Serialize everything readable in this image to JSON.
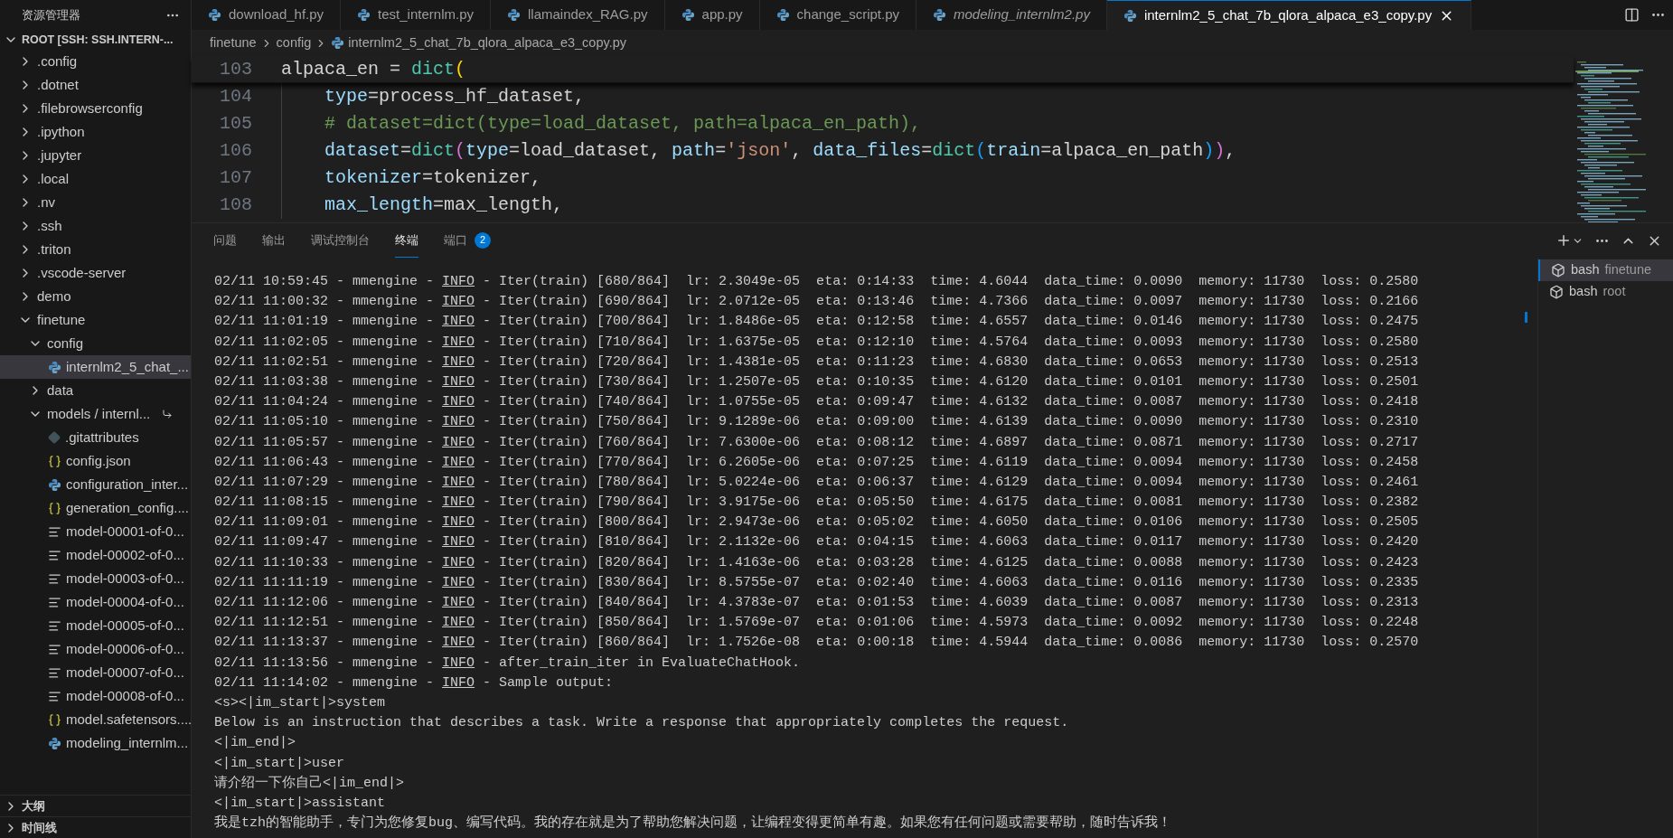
{
  "sidebar": {
    "title": "资源管理器",
    "root": {
      "label": "ROOT [SSH: SSH.INTERN-...",
      "expanded": true,
      "children": [
        {
          "label": ".config",
          "kind": "folder",
          "expanded": false,
          "selected": false
        },
        {
          "label": ".dotnet",
          "kind": "folder",
          "expanded": false,
          "selected": false
        },
        {
          "label": ".filebrowserconfig",
          "kind": "folder",
          "expanded": false,
          "selected": false
        },
        {
          "label": ".ipython",
          "kind": "folder",
          "expanded": false,
          "selected": false
        },
        {
          "label": ".jupyter",
          "kind": "folder",
          "expanded": false,
          "selected": false
        },
        {
          "label": ".local",
          "kind": "folder",
          "expanded": false,
          "selected": false
        },
        {
          "label": ".nv",
          "kind": "folder",
          "expanded": false,
          "selected": false
        },
        {
          "label": ".ssh",
          "kind": "folder",
          "expanded": false,
          "selected": false
        },
        {
          "label": ".triton",
          "kind": "folder",
          "expanded": false,
          "selected": false
        },
        {
          "label": ".vscode-server",
          "kind": "folder",
          "expanded": false,
          "selected": false
        },
        {
          "label": "demo",
          "kind": "folder",
          "expanded": false,
          "selected": false
        },
        {
          "label": "finetune",
          "kind": "folder",
          "expanded": true,
          "selected": false,
          "children": [
            {
              "label": "config",
              "kind": "folder",
              "expanded": true,
              "selected": false,
              "children": [
                {
                  "label": "internlm2_5_chat_...",
                  "kind": "python",
                  "selected": true
                }
              ]
            },
            {
              "label": "data",
              "kind": "folder",
              "expanded": false,
              "selected": false
            },
            {
              "label": "models / internl...",
              "kind": "folder",
              "expanded": true,
              "selected": false,
              "symlink": true,
              "children": [
                {
                  "label": ".gitattributes",
                  "kind": "git",
                  "selected": false
                },
                {
                  "label": "config.json",
                  "kind": "json",
                  "selected": false
                },
                {
                  "label": "configuration_inter...",
                  "kind": "python",
                  "selected": false
                },
                {
                  "label": "generation_config....",
                  "kind": "json",
                  "selected": false
                },
                {
                  "label": "model-00001-of-0...",
                  "kind": "text",
                  "selected": false
                },
                {
                  "label": "model-00002-of-0...",
                  "kind": "text",
                  "selected": false
                },
                {
                  "label": "model-00003-of-0...",
                  "kind": "text",
                  "selected": false
                },
                {
                  "label": "model-00004-of-0...",
                  "kind": "text",
                  "selected": false
                },
                {
                  "label": "model-00005-of-0...",
                  "kind": "text",
                  "selected": false
                },
                {
                  "label": "model-00006-of-0...",
                  "kind": "text",
                  "selected": false
                },
                {
                  "label": "model-00007-of-0...",
                  "kind": "text",
                  "selected": false
                },
                {
                  "label": "model-00008-of-0...",
                  "kind": "text",
                  "selected": false
                },
                {
                  "label": "model.safetensors....",
                  "kind": "json",
                  "selected": false
                },
                {
                  "label": "modeling_internlm...",
                  "kind": "python",
                  "selected": false
                }
              ]
            }
          ]
        }
      ]
    },
    "sections": [
      {
        "label": "大纲",
        "expanded": false
      },
      {
        "label": "时间线",
        "expanded": false
      }
    ]
  },
  "tabs": [
    {
      "label": "download_hf.py",
      "selected": false,
      "preview": false
    },
    {
      "label": "test_internlm.py",
      "selected": false,
      "preview": false
    },
    {
      "label": "llamaindex_RAG.py",
      "selected": false,
      "preview": false
    },
    {
      "label": "app.py",
      "selected": false,
      "preview": false
    },
    {
      "label": "change_script.py",
      "selected": false,
      "preview": false
    },
    {
      "label": "modeling_internlm2.py",
      "selected": false,
      "preview": true
    },
    {
      "label": "internlm2_5_chat_7b_qlora_alpaca_e3_copy.py",
      "selected": true,
      "preview": false
    }
  ],
  "breadcrumb": [
    "finetune",
    "config",
    "internlm2_5_chat_7b_qlora_alpaca_e3_copy.py"
  ],
  "code_lines": [
    {
      "number": "103",
      "sticky": true,
      "indented": false,
      "tokens": [
        {
          "text": "alpaca_en",
          "kind": "plain"
        },
        {
          "text": " = ",
          "kind": "plain"
        },
        {
          "text": "dict",
          "kind": "func"
        },
        {
          "text": "(",
          "kind": "paren1"
        }
      ]
    },
    {
      "number": "104",
      "sticky": false,
      "indented": true,
      "tokens": [
        {
          "text": "type",
          "kind": "param"
        },
        {
          "text": "=process_hf_dataset,",
          "kind": "plain"
        }
      ]
    },
    {
      "number": "105",
      "sticky": false,
      "indented": true,
      "tokens": [
        {
          "text": "# dataset=dict(type=load_dataset, path=alpaca_en_path),",
          "kind": "comment"
        }
      ]
    },
    {
      "number": "106",
      "sticky": false,
      "indented": true,
      "tokens": [
        {
          "text": "dataset",
          "kind": "param"
        },
        {
          "text": "=",
          "kind": "plain"
        },
        {
          "text": "dict",
          "kind": "func"
        },
        {
          "text": "(",
          "kind": "paren2"
        },
        {
          "text": "type",
          "kind": "param"
        },
        {
          "text": "=load_dataset, ",
          "kind": "plain"
        },
        {
          "text": "path",
          "kind": "param"
        },
        {
          "text": "=",
          "kind": "plain"
        },
        {
          "text": "'json'",
          "kind": "string"
        },
        {
          "text": ", ",
          "kind": "plain"
        },
        {
          "text": "data_files",
          "kind": "param"
        },
        {
          "text": "=",
          "kind": "plain"
        },
        {
          "text": "dict",
          "kind": "func"
        },
        {
          "text": "(",
          "kind": "paren3"
        },
        {
          "text": "train",
          "kind": "param"
        },
        {
          "text": "=alpaca_en_path",
          "kind": "plain"
        },
        {
          "text": ")",
          "kind": "paren3"
        },
        {
          "text": ")",
          "kind": "paren2"
        },
        {
          "text": ",",
          "kind": "plain"
        }
      ]
    },
    {
      "number": "107",
      "sticky": false,
      "indented": true,
      "tokens": [
        {
          "text": "tokenizer",
          "kind": "param"
        },
        {
          "text": "=tokenizer,",
          "kind": "plain"
        }
      ]
    },
    {
      "number": "108",
      "sticky": false,
      "indented": true,
      "tokens": [
        {
          "text": "max_length",
          "kind": "param"
        },
        {
          "text": "=max_length,",
          "kind": "plain"
        }
      ]
    }
  ],
  "panel_tabs": [
    {
      "label": "问题",
      "selected": false
    },
    {
      "label": "输出",
      "selected": false
    },
    {
      "label": "调试控制台",
      "selected": false
    },
    {
      "label": "终端",
      "selected": true
    },
    {
      "label": "端口",
      "selected": false,
      "badge": "2"
    }
  ],
  "terminal": {
    "lines": [
      {
        "kind": "log",
        "prefix": "02/11 10:59:45 - mmengine - ",
        "level": "INFO",
        "message": " - Iter(train) [680/864]  lr: 2.3049e-05  eta: 0:14:33  time: 4.6044  data_time: 0.0090  memory: 11730  loss: 0.2580"
      },
      {
        "kind": "log",
        "prefix": "02/11 11:00:32 - mmengine - ",
        "level": "INFO",
        "message": " - Iter(train) [690/864]  lr: 2.0712e-05  eta: 0:13:46  time: 4.7366  data_time: 0.0097  memory: 11730  loss: 0.2166"
      },
      {
        "kind": "log",
        "prefix": "02/11 11:01:19 - mmengine - ",
        "level": "INFO",
        "message": " - Iter(train) [700/864]  lr: 1.8486e-05  eta: 0:12:58  time: 4.6557  data_time: 0.0146  memory: 11730  loss: 0.2475"
      },
      {
        "kind": "log",
        "prefix": "02/11 11:02:05 - mmengine - ",
        "level": "INFO",
        "message": " - Iter(train) [710/864]  lr: 1.6375e-05  eta: 0:12:10  time: 4.5764  data_time: 0.0093  memory: 11730  loss: 0.2580"
      },
      {
        "kind": "log",
        "prefix": "02/11 11:02:51 - mmengine - ",
        "level": "INFO",
        "message": " - Iter(train) [720/864]  lr: 1.4381e-05  eta: 0:11:23  time: 4.6830  data_time: 0.0653  memory: 11730  loss: 0.2513"
      },
      {
        "kind": "log",
        "prefix": "02/11 11:03:38 - mmengine - ",
        "level": "INFO",
        "message": " - Iter(train) [730/864]  lr: 1.2507e-05  eta: 0:10:35  time: 4.6120  data_time: 0.0101  memory: 11730  loss: 0.2501"
      },
      {
        "kind": "log",
        "prefix": "02/11 11:04:24 - mmengine - ",
        "level": "INFO",
        "message": " - Iter(train) [740/864]  lr: 1.0755e-05  eta: 0:09:47  time: 4.6132  data_time: 0.0087  memory: 11730  loss: 0.2418"
      },
      {
        "kind": "log",
        "prefix": "02/11 11:05:10 - mmengine - ",
        "level": "INFO",
        "message": " - Iter(train) [750/864]  lr: 9.1289e-06  eta: 0:09:00  time: 4.6139  data_time: 0.0090  memory: 11730  loss: 0.2310"
      },
      {
        "kind": "log",
        "prefix": "02/11 11:05:57 - mmengine - ",
        "level": "INFO",
        "message": " - Iter(train) [760/864]  lr: 7.6300e-06  eta: 0:08:12  time: 4.6897  data_time: 0.0871  memory: 11730  loss: 0.2717"
      },
      {
        "kind": "log",
        "prefix": "02/11 11:06:43 - mmengine - ",
        "level": "INFO",
        "message": " - Iter(train) [770/864]  lr: 6.2605e-06  eta: 0:07:25  time: 4.6119  data_time: 0.0094  memory: 11730  loss: 0.2458"
      },
      {
        "kind": "log",
        "prefix": "02/11 11:07:29 - mmengine - ",
        "level": "INFO",
        "message": " - Iter(train) [780/864]  lr: 5.0224e-06  eta: 0:06:37  time: 4.6129  data_time: 0.0094  memory: 11730  loss: 0.2461"
      },
      {
        "kind": "log",
        "prefix": "02/11 11:08:15 - mmengine - ",
        "level": "INFO",
        "message": " - Iter(train) [790/864]  lr: 3.9175e-06  eta: 0:05:50  time: 4.6175  data_time: 0.0081  memory: 11730  loss: 0.2382"
      },
      {
        "kind": "log",
        "prefix": "02/11 11:09:01 - mmengine - ",
        "level": "INFO",
        "message": " - Iter(train) [800/864]  lr: 2.9473e-06  eta: 0:05:02  time: 4.6050  data_time: 0.0106  memory: 11730  loss: 0.2505"
      },
      {
        "kind": "log",
        "prefix": "02/11 11:09:47 - mmengine - ",
        "level": "INFO",
        "message": " - Iter(train) [810/864]  lr: 2.1132e-06  eta: 0:04:15  time: 4.6063  data_time: 0.0117  memory: 11730  loss: 0.2420"
      },
      {
        "kind": "log",
        "prefix": "02/11 11:10:33 - mmengine - ",
        "level": "INFO",
        "message": " - Iter(train) [820/864]  lr: 1.4163e-06  eta: 0:03:28  time: 4.6125  data_time: 0.0088  memory: 11730  loss: 0.2423"
      },
      {
        "kind": "log",
        "prefix": "02/11 11:11:19 - mmengine - ",
        "level": "INFO",
        "message": " - Iter(train) [830/864]  lr: 8.5755e-07  eta: 0:02:40  time: 4.6063  data_time: 0.0116  memory: 11730  loss: 0.2335"
      },
      {
        "kind": "log",
        "prefix": "02/11 11:12:06 - mmengine - ",
        "level": "INFO",
        "message": " - Iter(train) [840/864]  lr: 4.3783e-07  eta: 0:01:53  time: 4.6039  data_time: 0.0087  memory: 11730  loss: 0.2313"
      },
      {
        "kind": "log",
        "prefix": "02/11 11:12:51 - mmengine - ",
        "level": "INFO",
        "message": " - Iter(train) [850/864]  lr: 1.5769e-07  eta: 0:01:06  time: 4.5973  data_time: 0.0092  memory: 11730  loss: 0.2248"
      },
      {
        "kind": "log",
        "prefix": "02/11 11:13:37 - mmengine - ",
        "level": "INFO",
        "message": " - Iter(train) [860/864]  lr: 1.7526e-08  eta: 0:00:18  time: 4.5944  data_time: 0.0086  memory: 11730  loss: 0.2570"
      },
      {
        "kind": "log",
        "prefix": "02/11 11:13:56 - mmengine - ",
        "level": "INFO",
        "message": " - after_train_iter in EvaluateChatHook."
      },
      {
        "kind": "log",
        "prefix": "02/11 11:14:02 - mmengine - ",
        "level": "INFO",
        "message": " - Sample output:"
      },
      {
        "kind": "text",
        "text": "<s><|im_start|>system"
      },
      {
        "kind": "text",
        "text": "Below is an instruction that describes a task. Write a response that appropriately completes the request."
      },
      {
        "kind": "text",
        "text": "<|im_end|>"
      },
      {
        "kind": "text",
        "text": "<|im_start|>user"
      },
      {
        "kind": "text",
        "text": "请介绍一下你自己<|im_end|>"
      },
      {
        "kind": "text",
        "text": "<|im_start|>assistant"
      },
      {
        "kind": "text",
        "text": "我是tzh的智能助手，专门为您修复bug、编写代码。我的存在就是为了帮助您解决问题，让编程变得更简单有趣。如果您有任何问题或需要帮助，随时告诉我！"
      }
    ],
    "sessions": [
      {
        "name": "bash",
        "cwd": "finetune",
        "selected": true
      },
      {
        "name": "bash",
        "cwd": "root",
        "selected": false
      }
    ]
  }
}
